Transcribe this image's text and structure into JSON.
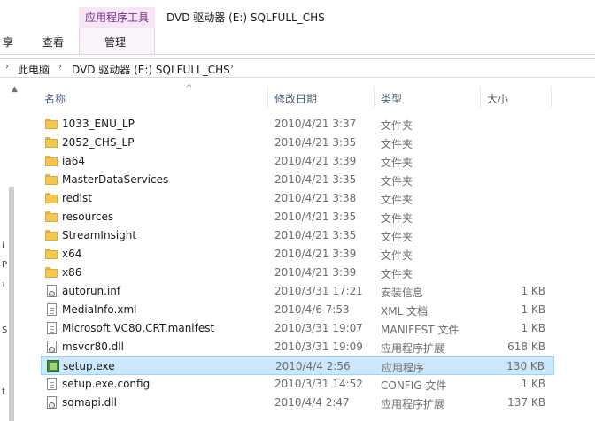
{
  "window": {
    "title": "DVD 驱动器 (E:) SQLFULL_CHS",
    "context_group": "应用程序工具",
    "tabs": {
      "share_fragment": "享",
      "view": "查看",
      "manage": "管理"
    }
  },
  "breadcrumb": [
    "此电脑",
    "DVD 驱动器 (E:) SQLFULL_CHS"
  ],
  "nav_fragments": [
    "i",
    "P",
    "›",
    "S",
    "t"
  ],
  "columns": {
    "name": "名称",
    "date": "修改日期",
    "type": "类型",
    "size": "大小"
  },
  "files": [
    {
      "name": "1033_ENU_LP",
      "date": "2010/4/21 3:37",
      "type": "文件夹",
      "size": "",
      "icon": "folder-icon"
    },
    {
      "name": "2052_CHS_LP",
      "date": "2010/4/21 3:35",
      "type": "文件夹",
      "size": "",
      "icon": "folder-icon"
    },
    {
      "name": "ia64",
      "date": "2010/4/21 3:39",
      "type": "文件夹",
      "size": "",
      "icon": "folder-icon"
    },
    {
      "name": "MasterDataServices",
      "date": "2010/4/21 3:35",
      "type": "文件夹",
      "size": "",
      "icon": "folder-icon"
    },
    {
      "name": "redist",
      "date": "2010/4/21 3:38",
      "type": "文件夹",
      "size": "",
      "icon": "folder-icon"
    },
    {
      "name": "resources",
      "date": "2010/4/21 3:35",
      "type": "文件夹",
      "size": "",
      "icon": "folder-icon"
    },
    {
      "name": "StreamInsight",
      "date": "2010/4/21 3:35",
      "type": "文件夹",
      "size": "",
      "icon": "folder-icon"
    },
    {
      "name": "x64",
      "date": "2010/4/21 3:39",
      "type": "文件夹",
      "size": "",
      "icon": "folder-icon"
    },
    {
      "name": "x86",
      "date": "2010/4/21 3:39",
      "type": "文件夹",
      "size": "",
      "icon": "folder-icon"
    },
    {
      "name": "autorun.inf",
      "date": "2010/3/31 17:21",
      "type": "安装信息",
      "size": "1 KB",
      "icon": "gear-doc-icon"
    },
    {
      "name": "MediaInfo.xml",
      "date": "2010/4/6 7:53",
      "type": "XML 文档",
      "size": "1 KB",
      "icon": "doc-icon"
    },
    {
      "name": "Microsoft.VC80.CRT.manifest",
      "date": "2010/3/31 19:07",
      "type": "MANIFEST 文件",
      "size": "1 KB",
      "icon": "doc-icon"
    },
    {
      "name": "msvcr80.dll",
      "date": "2010/3/31 19:09",
      "type": "应用程序扩展",
      "size": "618 KB",
      "icon": "gear-doc-icon"
    },
    {
      "name": "setup.exe",
      "date": "2010/4/4 2:56",
      "type": "应用程序",
      "size": "130 KB",
      "icon": "exe-icon",
      "selected": true
    },
    {
      "name": "setup.exe.config",
      "date": "2010/3/31 14:52",
      "type": "CONFIG 文件",
      "size": "1 KB",
      "icon": "doc-icon"
    },
    {
      "name": "sqmapi.dll",
      "date": "2010/4/4 2:47",
      "type": "应用程序扩展",
      "size": "137 KB",
      "icon": "gear-doc-icon"
    }
  ]
}
